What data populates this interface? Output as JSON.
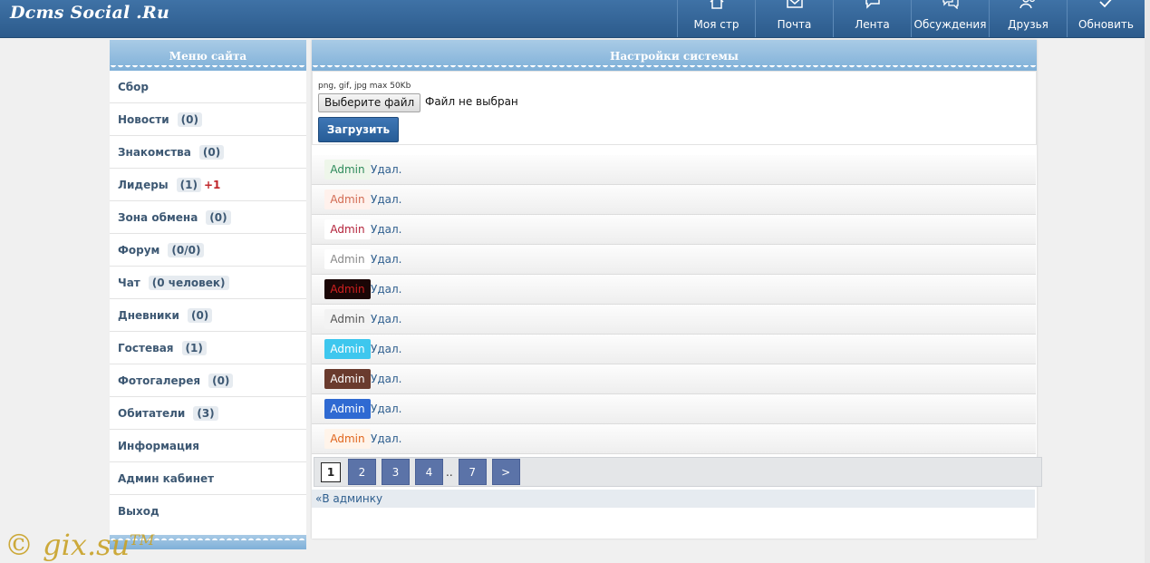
{
  "header": {
    "logo": "Dcms Social .Ru",
    "nav": [
      {
        "label": "Моя стр",
        "icon": "home-icon"
      },
      {
        "label": "Почта",
        "icon": "mail-icon"
      },
      {
        "label": "Лента",
        "icon": "speech-bubble-icon"
      },
      {
        "label": "Обсуждения",
        "icon": "discussion-icon"
      },
      {
        "label": "Друзья",
        "icon": "friends-icon"
      },
      {
        "label": "Обновить",
        "icon": "checkmark-icon"
      }
    ]
  },
  "sidebar": {
    "title": "Меню сайта",
    "items": [
      {
        "label": "Сбор",
        "count": ""
      },
      {
        "label": "Новости",
        "count": "(0)"
      },
      {
        "label": "Знакомства",
        "count": "(0)"
      },
      {
        "label": "Лидеры",
        "count": "(1)",
        "extra": "+1"
      },
      {
        "label": "Зона обмена",
        "count": "(0)"
      },
      {
        "label": "Форум",
        "count": "(0/0)"
      },
      {
        "label": "Чат",
        "count": "(0 человек)"
      },
      {
        "label": "Дневники",
        "count": "(0)"
      },
      {
        "label": "Гостевая",
        "count": "(1)"
      },
      {
        "label": "Фотогалерея",
        "count": "(0)"
      },
      {
        "label": "Обитатели",
        "count": "(3)"
      },
      {
        "label": "Информация",
        "count": ""
      },
      {
        "label": "Админ кабинет",
        "count": ""
      },
      {
        "label": "Выход",
        "count": ""
      }
    ]
  },
  "main": {
    "title": "Настройки системы",
    "upload": {
      "hint": "png, gif, jpg max 50Kb",
      "choose_label": "Выберите файл",
      "file_status": "Файл не выбран",
      "submit_label": "Загрузить"
    },
    "icons": [
      {
        "text": "Admin",
        "bg": "#eef6ea",
        "fg": "#2d8a5a",
        "delete": "Удал."
      },
      {
        "text": "Admin",
        "bg": "#fff1ec",
        "fg": "#d26a52",
        "delete": "Удал."
      },
      {
        "text": "Admin",
        "bg": "#ffffff",
        "fg": "#b3223a",
        "delete": "Удал."
      },
      {
        "text": "Admin",
        "bg": "#ffffff",
        "fg": "#888888",
        "delete": "Удал."
      },
      {
        "text": "Admin",
        "bg": "#1a0606",
        "fg": "#d02020",
        "delete": "Удал."
      },
      {
        "text": "Admin",
        "bg": "#f3f3f3",
        "fg": "#555555",
        "delete": "Удал."
      },
      {
        "text": "Admin",
        "bg": "#3ec7ee",
        "fg": "#ffffff",
        "delete": "Удал."
      },
      {
        "text": "Admin",
        "bg": "#6a3b2e",
        "fg": "#ffffff",
        "delete": "Удал."
      },
      {
        "text": "Admin",
        "bg": "#2f6ad2",
        "fg": "#ffffff",
        "delete": "Удал."
      },
      {
        "text": "Admin",
        "bg": "#fff4ea",
        "fg": "#e0651d",
        "delete": "Удал."
      }
    ],
    "pagination": {
      "current": "1",
      "pages": [
        "2",
        "3",
        "4"
      ],
      "ellipsis": "..",
      "last": "7",
      "next": ">"
    },
    "back_prefix": "«",
    "back_link": "В админку"
  },
  "watermark": {
    "text": "© gix.su",
    "tm": "TM"
  }
}
